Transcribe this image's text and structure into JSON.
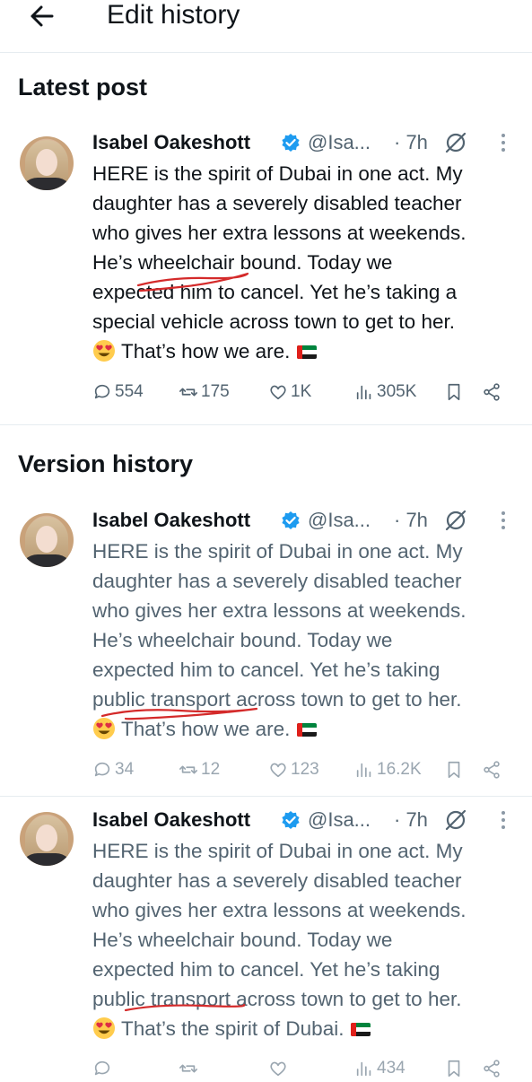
{
  "header": {
    "title": "Edit history"
  },
  "sections": {
    "latest": "Latest post",
    "versions": "Version history"
  },
  "posts": [
    {
      "name": "Isabel Oakeshott",
      "handle": "@Isa...",
      "time": "· 7h",
      "lines": [
        "HERE is the spirit of Dubai in one act. My",
        "daughter has a severely disabled teacher",
        "who gives her extra lessons at weekends.",
        "He’s wheelchair bound. Today we",
        "expected him to cancel. Yet he’s taking a",
        "special vehicle across town to get to her."
      ],
      "last_line": "That’s how we are.",
      "stats": {
        "replies": "554",
        "reposts": "175",
        "likes": "1K",
        "views": "305K"
      }
    },
    {
      "name": "Isabel Oakeshott",
      "handle": "@Isa...",
      "time": "· 7h",
      "lines": [
        "HERE is the spirit of Dubai in one act. My",
        "daughter has a severely disabled teacher",
        "who gives her extra lessons at weekends.",
        "He’s wheelchair bound. Today we",
        "expected him to cancel. Yet he’s taking",
        "public transport across town to get to her."
      ],
      "last_line": "That’s how we are.",
      "stats": {
        "replies": "34",
        "reposts": "12",
        "likes": "123",
        "views": "16.2K"
      }
    },
    {
      "name": "Isabel Oakeshott",
      "handle": "@Isa...",
      "time": "· 7h",
      "lines": [
        "HERE is the spirit of Dubai in one act. My",
        "daughter has a severely disabled teacher",
        "who gives her extra lessons at weekends.",
        "He’s wheelchair bound. Today we",
        "expected him to cancel. Yet he’s taking",
        "public transport across town to get to her."
      ],
      "last_line": "That’s the spirit of Dubai.",
      "stats": {
        "replies": "",
        "reposts": "",
        "likes": "",
        "views": "434"
      }
    }
  ],
  "colors": {
    "text": "#0f1419",
    "secondary": "#536471",
    "verified": "#1d9bf0",
    "annotation": "#d42a2a",
    "divider": "#e6ecf0"
  },
  "icons": [
    "back-arrow-icon",
    "verified-badge-icon",
    "grok-icon",
    "more-icon",
    "reply-icon",
    "repost-icon",
    "like-icon",
    "views-icon",
    "bookmark-icon",
    "share-icon",
    "heart-eyes-emoji",
    "uae-flag-emoji"
  ]
}
